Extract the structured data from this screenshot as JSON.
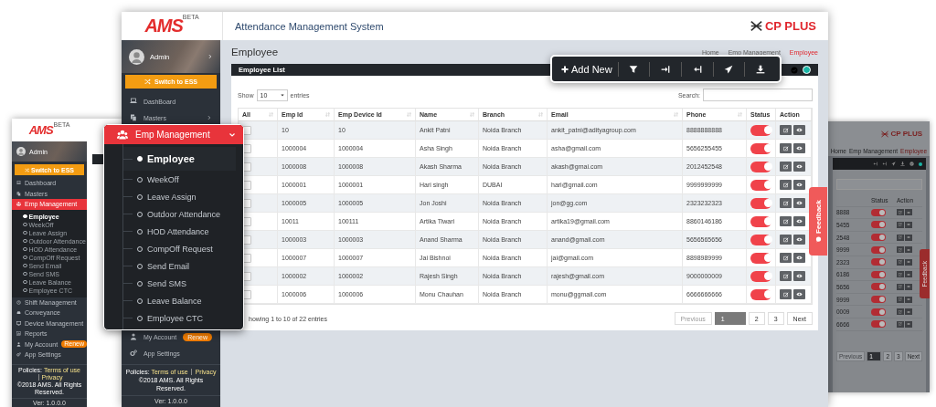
{
  "left_window": {
    "logo": "AMS",
    "logo_badge": "BETA",
    "user": "Admin",
    "switch_button": "Switch to ESS",
    "items": [
      {
        "label": "Dashboard",
        "selected": false
      },
      {
        "label": "Masters",
        "selected": false
      },
      {
        "label": "Emp Management",
        "selected": true,
        "children": [
          {
            "label": "Employee",
            "selected": true
          },
          {
            "label": "WeekOff",
            "selected": false
          },
          {
            "label": "Leave Assign",
            "selected": false
          },
          {
            "label": "Outdoor Attendance",
            "selected": false
          },
          {
            "label": "HOD Attendance",
            "selected": false
          },
          {
            "label": "CompOff Request",
            "selected": false
          },
          {
            "label": "Send Email",
            "selected": false
          },
          {
            "label": "Send SMS",
            "selected": false
          },
          {
            "label": "Leave Balance",
            "selected": false
          },
          {
            "label": "Employee CTC",
            "selected": false
          }
        ]
      },
      {
        "label": "Shift Management",
        "selected": false
      },
      {
        "label": "Conveyance",
        "selected": false
      },
      {
        "label": "Device Management",
        "selected": false
      },
      {
        "label": "Reports",
        "selected": false
      },
      {
        "label": "My Account",
        "selected": false,
        "badge": "Renew"
      },
      {
        "label": "App Settings",
        "selected": false
      }
    ],
    "footer": {
      "policies": "Policies:",
      "links": [
        "Terms of use",
        "Privacy"
      ],
      "copyright": "©2018 AMS. All Rights Reserved.",
      "version": "Ver: 1.0.0.0"
    }
  },
  "right_window": {
    "brand": "CP PLUS",
    "breadcrumb": [
      "Home",
      "Emp Management",
      "Employee"
    ],
    "columns": [
      "Status",
      "Action"
    ],
    "rows": [
      {
        "phone": "8888",
        "on": true
      },
      {
        "phone": "5455",
        "on": true
      },
      {
        "phone": "2548",
        "on": true
      },
      {
        "phone": "9999",
        "on": true
      },
      {
        "phone": "2323",
        "on": true
      },
      {
        "phone": "6186",
        "on": true
      },
      {
        "phone": "5656",
        "on": true
      },
      {
        "phone": "9999",
        "on": true
      },
      {
        "phone": "0009",
        "on": true
      },
      {
        "phone": "6666",
        "on": true
      }
    ],
    "pagination": [
      {
        "label": "Previous",
        "selected": false,
        "disabled": true
      },
      {
        "label": "1",
        "selected": true,
        "disabled": false
      },
      {
        "label": "2",
        "selected": false,
        "disabled": false
      },
      {
        "label": "3",
        "selected": false,
        "disabled": false
      },
      {
        "label": "Next",
        "selected": false,
        "disabled": false
      }
    ],
    "feedback": "Feedback"
  },
  "main_window": {
    "header": {
      "logo": "AMS",
      "logo_badge": "BETA",
      "title": "Attendance Management System",
      "brand": "CP PLUS"
    },
    "sidebar": {
      "user": "Admin",
      "switch_button": "Switch to ESS",
      "items": [
        {
          "label": "DashBoard",
          "selected": false
        },
        {
          "label": "Masters",
          "selected": false
        }
      ],
      "lower_items": [
        {
          "label": "My Account",
          "selected": false,
          "badge": "Renew"
        },
        {
          "label": "App Settings",
          "selected": false
        }
      ],
      "footer": {
        "policies": "Policies:",
        "links": [
          "Terms of use",
          "Privacy"
        ],
        "copyright": "©2018 AMS. All Rights Reserved.",
        "version": "Ver: 1.0.0.0"
      }
    },
    "page": {
      "title": "Employee",
      "breadcrumb": [
        {
          "label": "Home",
          "current": false
        },
        {
          "label": "Emp Management",
          "current": false
        },
        {
          "label": "Employee",
          "current": true
        }
      ],
      "card_title": "Employee List",
      "show_label": "Show",
      "page_size": "10",
      "entries_label": "entries",
      "search_label": "Search:",
      "table": {
        "columns": [
          "All",
          "Emp Id",
          "Emp Device Id",
          "Name",
          "Branch",
          "Email",
          "Phone",
          "Status",
          "Action"
        ],
        "rows": [
          {
            "checked": false,
            "emp_id": "10",
            "device_id": "10",
            "name": "Ankit Patni",
            "branch": "Noida Branch",
            "email": "ankit_patni@adityagroup.com",
            "phone": "8888888888",
            "status_on": true
          },
          {
            "checked": false,
            "emp_id": "1000004",
            "device_id": "1000004",
            "name": "Asha Singh",
            "branch": "Noida Branch",
            "email": "asha@gmail.com",
            "phone": "5656255455",
            "status_on": true
          },
          {
            "checked": false,
            "emp_id": "1000008",
            "device_id": "1000008",
            "name": "Akash Sharma",
            "branch": "Noida Branch",
            "email": "akash@gmai.com",
            "phone": "2012452548",
            "status_on": true
          },
          {
            "checked": false,
            "emp_id": "1000001",
            "device_id": "1000001",
            "name": "Hari singh",
            "branch": "DUBAI",
            "email": "hari@gmail.com",
            "phone": "9999999999",
            "status_on": true
          },
          {
            "checked": false,
            "emp_id": "1000005",
            "device_id": "1000005",
            "name": "Jon Joshi",
            "branch": "Noida Branch",
            "email": "jon@gg.com",
            "phone": "2323232323",
            "status_on": true
          },
          {
            "checked": false,
            "emp_id": "10011",
            "device_id": "100111",
            "name": "Artika Tiwari",
            "branch": "Noida Branch",
            "email": "artika19@gmail.com",
            "phone": "8860146186",
            "status_on": true
          },
          {
            "checked": false,
            "emp_id": "1000003",
            "device_id": "1000003",
            "name": "Anand Sharma",
            "branch": "Noida Branch",
            "email": "anand@gmail.com",
            "phone": "5656565656",
            "status_on": true
          },
          {
            "checked": false,
            "emp_id": "1000007",
            "device_id": "1000007",
            "name": "Jai Bishnoi",
            "branch": "Noida Branch",
            "email": "jai@gmail.com",
            "phone": "8898989999",
            "status_on": true
          },
          {
            "checked": false,
            "emp_id": "1000002",
            "device_id": "1000002",
            "name": "Rajesh Singh",
            "branch": "Noida Branch",
            "email": "rajesh@gmail.com",
            "phone": "9000000009",
            "status_on": true
          },
          {
            "checked": false,
            "emp_id": "1000006",
            "device_id": "1000006",
            "name": "Monu Chauhan",
            "branch": "Noida Branch",
            "email": "monu@ggmail.com",
            "phone": "6666666666",
            "status_on": true
          }
        ]
      },
      "info": "howing 1 to 10 of 22 entries",
      "pagination": [
        {
          "label": "Previous",
          "selected": false,
          "disabled": true
        },
        {
          "label": "1",
          "selected": true,
          "disabled": false
        },
        {
          "label": "2",
          "selected": false,
          "disabled": false
        },
        {
          "label": "3",
          "selected": false,
          "disabled": false
        },
        {
          "label": "Next",
          "selected": false,
          "disabled": false
        }
      ]
    },
    "feedback": "Feedback"
  },
  "toolbar_popout": {
    "add_button": "Add New"
  },
  "flyout_menu": {
    "title": "Emp Management",
    "expanded": true,
    "items": [
      {
        "label": "Employee",
        "selected": true
      },
      {
        "label": "WeekOff",
        "selected": false
      },
      {
        "label": "Leave Assign",
        "selected": false
      },
      {
        "label": "Outdoor Attendance",
        "selected": false
      },
      {
        "label": "HOD Attendance",
        "selected": false
      },
      {
        "label": "CompOff Request",
        "selected": false
      },
      {
        "label": "Send Email",
        "selected": false
      },
      {
        "label": "Send SMS",
        "selected": false
      },
      {
        "label": "Leave Balance",
        "selected": false
      },
      {
        "label": "Employee CTC",
        "selected": false
      }
    ]
  }
}
